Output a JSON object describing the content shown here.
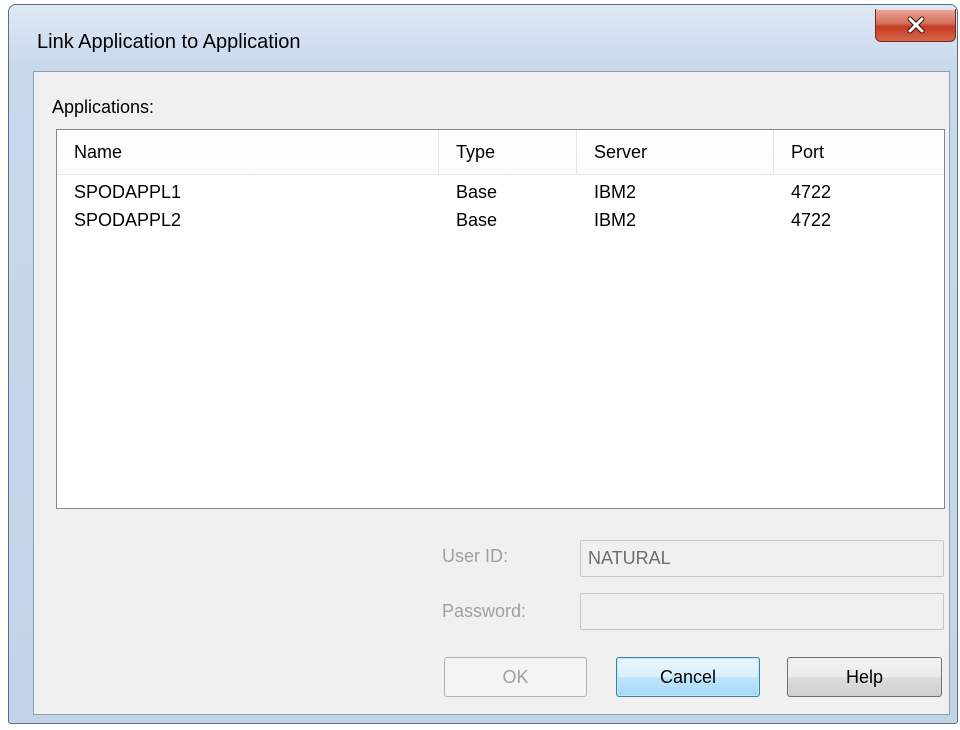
{
  "window": {
    "title": "Link Application to Application",
    "close_icon": "close-icon"
  },
  "applications": {
    "label": "Applications:",
    "columns": [
      "Name",
      "Type",
      "Server",
      "Port"
    ],
    "rows": [
      {
        "name": "SPODAPPL1",
        "type": "Base",
        "server": "IBM2",
        "port": "4722"
      },
      {
        "name": "SPODAPPL2",
        "type": "Base",
        "server": "IBM2",
        "port": "4722"
      }
    ]
  },
  "form": {
    "user_id_label": "User ID:",
    "user_id_value": "NATURAL",
    "password_label": "Password:",
    "password_value": ""
  },
  "buttons": {
    "ok": "OK",
    "cancel": "Cancel",
    "help": "Help"
  },
  "colors": {
    "close_button": "#c94a2e",
    "default_button_border": "#3c7fb1"
  }
}
